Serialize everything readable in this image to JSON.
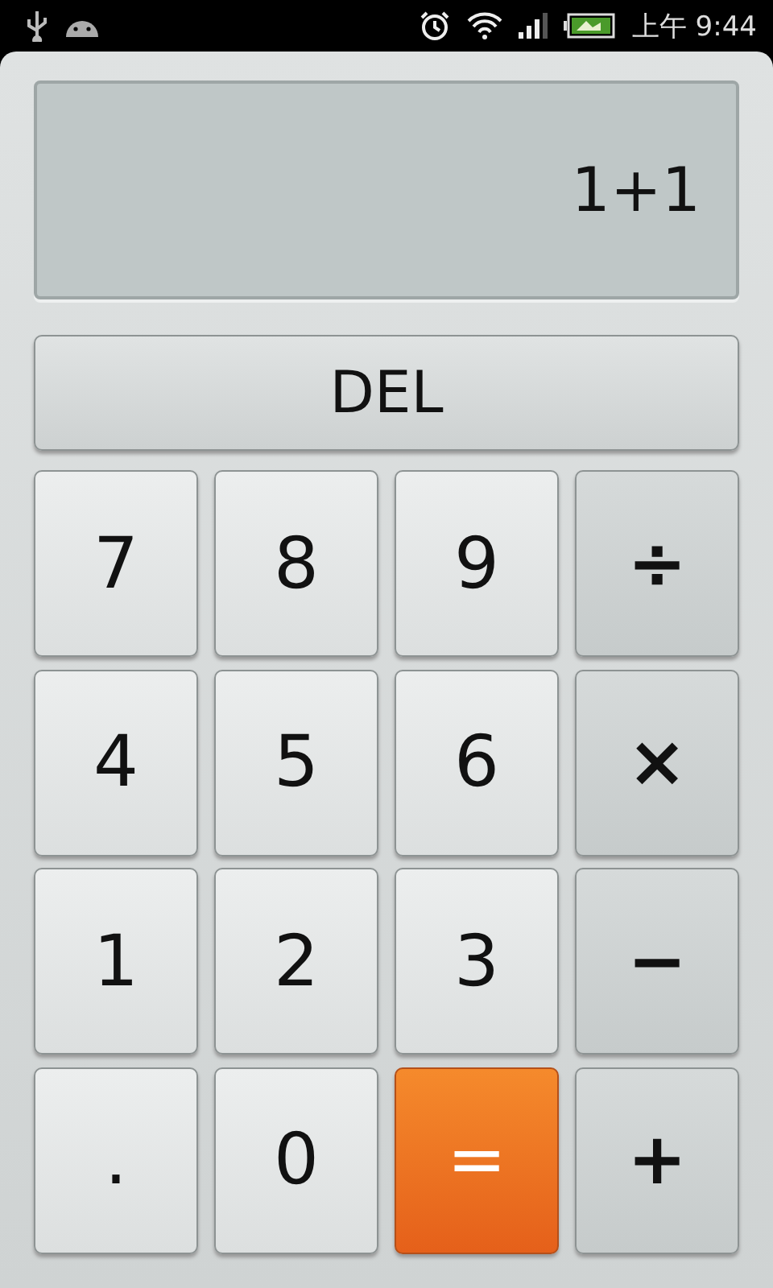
{
  "status_bar": {
    "time": "上午 9:44"
  },
  "display": {
    "expression": "1+1"
  },
  "delete_button": {
    "label": "DEL"
  },
  "keys": [
    {
      "label": "7",
      "kind": "digit"
    },
    {
      "label": "8",
      "kind": "digit"
    },
    {
      "label": "9",
      "kind": "digit"
    },
    {
      "label": "÷",
      "kind": "operator"
    },
    {
      "label": "4",
      "kind": "digit"
    },
    {
      "label": "5",
      "kind": "digit"
    },
    {
      "label": "6",
      "kind": "digit"
    },
    {
      "label": "×",
      "kind": "operator"
    },
    {
      "label": "1",
      "kind": "digit"
    },
    {
      "label": "2",
      "kind": "digit"
    },
    {
      "label": "3",
      "kind": "digit"
    },
    {
      "label": "−",
      "kind": "operator"
    },
    {
      "label": ".",
      "kind": "digit"
    },
    {
      "label": "0",
      "kind": "digit"
    },
    {
      "label": "=",
      "kind": "equals"
    },
    {
      "label": "+",
      "kind": "operator"
    }
  ]
}
